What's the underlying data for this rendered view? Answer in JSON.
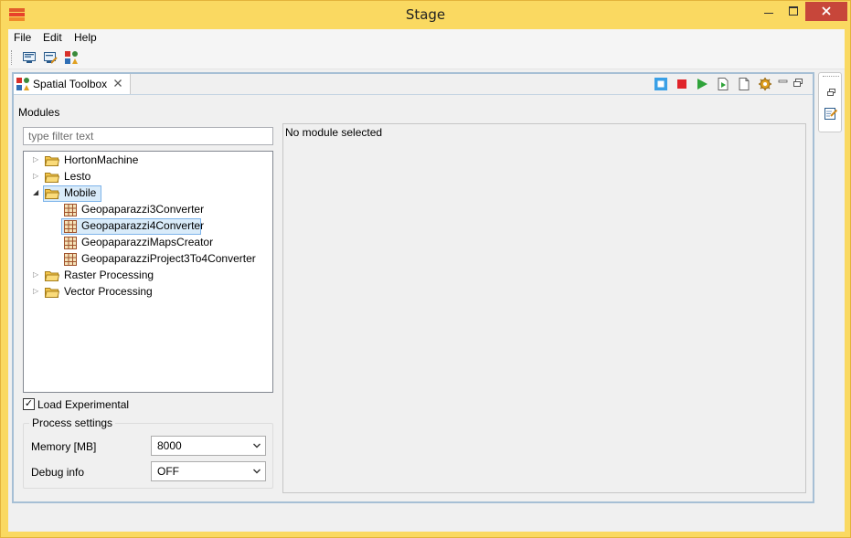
{
  "window": {
    "title": "Stage"
  },
  "menu": [
    "File",
    "Edit",
    "Help"
  ],
  "view": {
    "tab_label": "Spatial Toolbox",
    "modules_label": "Modules",
    "filter_placeholder": "type filter text",
    "tree": [
      {
        "label": "HortonMachine",
        "type": "folder",
        "expanded": false
      },
      {
        "label": "Lesto",
        "type": "folder",
        "expanded": false
      },
      {
        "label": "Mobile",
        "type": "folder",
        "expanded": true,
        "selected": true,
        "children": [
          {
            "label": "Geopaparazzi3Converter",
            "type": "module"
          },
          {
            "label": "Geopaparazzi4Converter",
            "type": "module",
            "selected": true
          },
          {
            "label": "GeopaparazziMapsCreator",
            "type": "module"
          },
          {
            "label": "GeopaparazziProject3To4Converter",
            "type": "module"
          }
        ]
      },
      {
        "label": "Raster Processing",
        "type": "folder",
        "expanded": false
      },
      {
        "label": "Vector Processing",
        "type": "folder",
        "expanded": false
      }
    ],
    "load_experimental": {
      "label": "Load Experimental",
      "checked": true
    },
    "process_settings": {
      "title": "Process settings",
      "memory_label": "Memory [MB]",
      "memory_value": "8000",
      "debug_label": "Debug info",
      "debug_value": "OFF"
    },
    "details_text": "No module selected"
  },
  "colors": {
    "titlebar": "#fad961",
    "close": "#c7463a",
    "view_border": "#a6bfd5",
    "selection": "#d9ebf9"
  }
}
